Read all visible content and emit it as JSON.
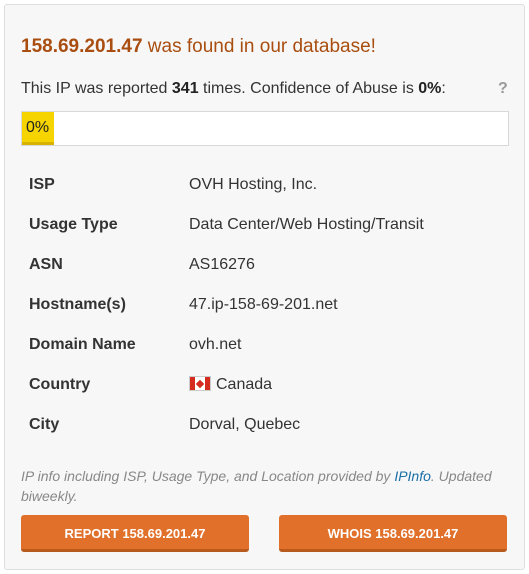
{
  "header": {
    "ip": "158.69.201.47",
    "found_text": " was found in our database!"
  },
  "report_summary": {
    "prefix": "This IP was reported ",
    "count": "341",
    "middle": " times. Confidence of Abuse is ",
    "confidence": "0%",
    "suffix": ":",
    "help_label": "?"
  },
  "confidence_bar": {
    "label": "0%",
    "value_percent": 0,
    "color": "#f5d400"
  },
  "details": {
    "isp": {
      "key": "ISP",
      "value": "OVH Hosting, Inc."
    },
    "usage_type": {
      "key": "Usage Type",
      "value": "Data Center/Web Hosting/Transit"
    },
    "asn": {
      "key": "ASN",
      "value": "AS16276"
    },
    "hostname": {
      "key": "Hostname(s)",
      "value": "47.ip-158-69-201.net"
    },
    "domain": {
      "key": "Domain Name",
      "value": "ovh.net"
    },
    "country": {
      "key": "Country",
      "value": "Canada",
      "flag_icon": "canada-flag-icon"
    },
    "city": {
      "key": "City",
      "value": "Dorval, Quebec"
    }
  },
  "footnote": {
    "before": "IP info including ISP, Usage Type, and Location provided by ",
    "link": "IPInfo",
    "after": ". Updated biweekly."
  },
  "buttons": {
    "report": "REPORT 158.69.201.47",
    "whois": "WHOIS 158.69.201.47"
  },
  "colors": {
    "accent": "#e0702a",
    "headline": "#a94e10",
    "link": "#1a6fa8"
  }
}
